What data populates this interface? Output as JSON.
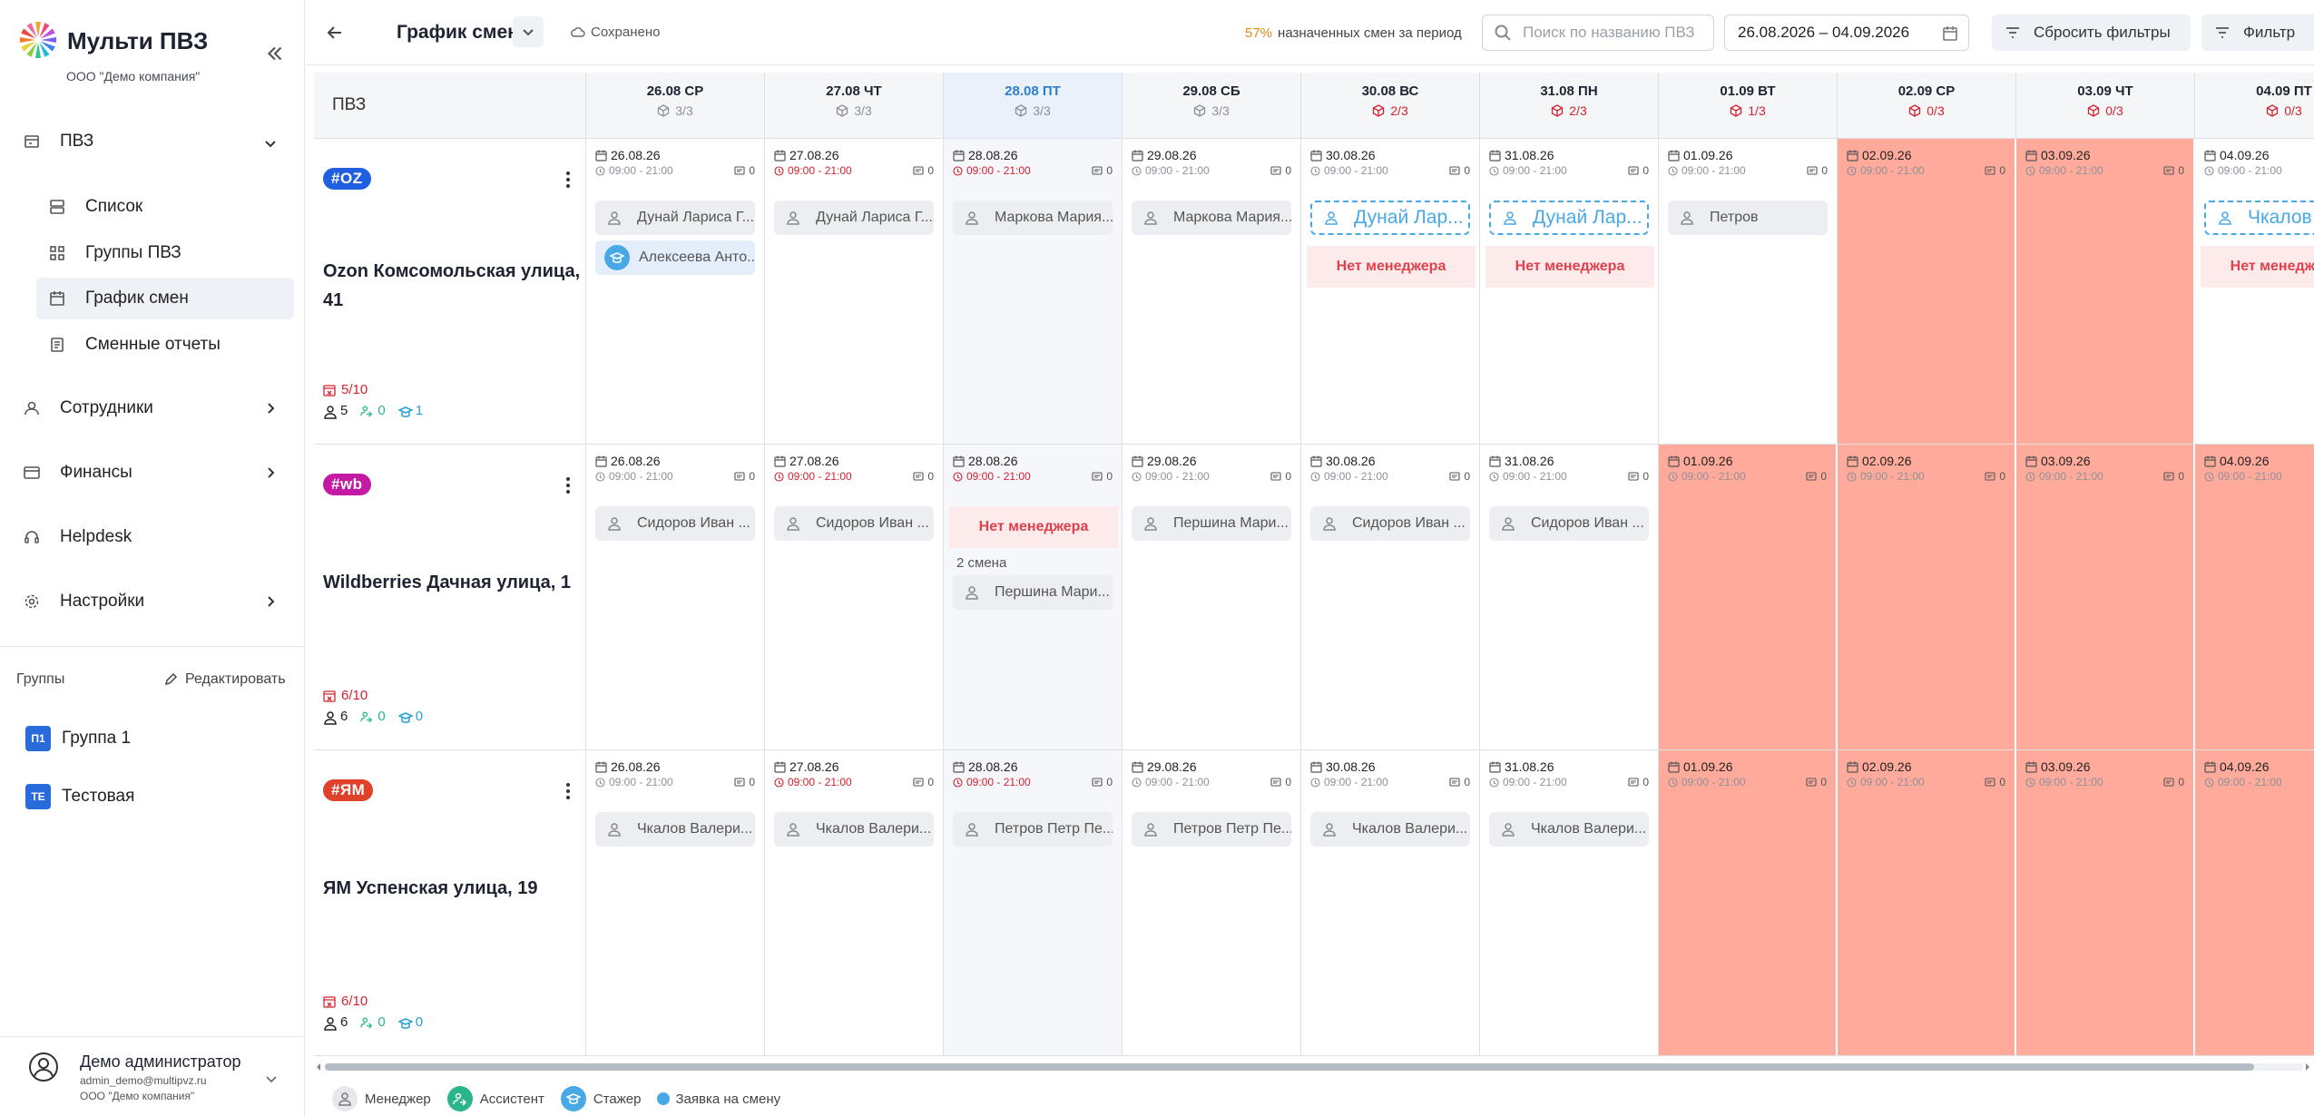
{
  "app": {
    "title": "Мульти ПВЗ",
    "org": "ООО \"Демо компания\""
  },
  "nav": {
    "pvz": "ПВЗ",
    "sub": [
      "Список",
      "Группы ПВЗ",
      "График смен",
      "Сменные отчеты"
    ],
    "employees": "Сотрудники",
    "finance": "Финансы",
    "helpdesk": "Helpdesk",
    "settings": "Настройки"
  },
  "groups": {
    "header": "Группы",
    "edit": "Редактировать",
    "items": [
      {
        "badge": "П1",
        "name": "Группа 1"
      },
      {
        "badge": "ТЕ",
        "name": "Тестовая"
      }
    ]
  },
  "user": {
    "name": "Демо администратор",
    "email": "admin_demo@multipvz.ru",
    "org": "ООО \"Демо компания\""
  },
  "header": {
    "title": "График смен",
    "saved": "Сохранено",
    "percent": "57%",
    "percent_label": "назначенных смен за период",
    "search_placeholder": "Поиск по названию ПВЗ",
    "date_range": "26.08.2026 – 04.09.2026",
    "reset": "Сбросить фильтры",
    "filter": "Фильтр"
  },
  "grid": {
    "pvz_header": "ПВЗ",
    "days": [
      {
        "label": "26.08 СР",
        "count": "3/3",
        "status": "ok"
      },
      {
        "label": "27.08 ЧТ",
        "count": "3/3",
        "status": "ok"
      },
      {
        "label": "28.08 ПТ",
        "count": "3/3",
        "status": "today"
      },
      {
        "label": "29.08 СБ",
        "count": "3/3",
        "status": "ok"
      },
      {
        "label": "30.08 ВС",
        "count": "2/3",
        "status": "bad"
      },
      {
        "label": "31.08 ПН",
        "count": "2/3",
        "status": "bad"
      },
      {
        "label": "01.09 ВТ",
        "count": "1/3",
        "status": "bad"
      },
      {
        "label": "02.09 СР",
        "count": "0/3",
        "status": "bad"
      },
      {
        "label": "03.09 ЧТ",
        "count": "0/3",
        "status": "bad"
      },
      {
        "label": "04.09 ПТ",
        "count": "0/3",
        "status": "bad"
      }
    ],
    "dates": [
      "26.08.26",
      "27.08.26",
      "28.08.26",
      "29.08.26",
      "30.08.26",
      "31.08.26",
      "01.09.26",
      "02.09.26",
      "03.09.26",
      "04.09.26"
    ],
    "time": "09:00 - 21:00",
    "cell_count": "0",
    "no_manager": "Нет менеджера",
    "shift2_label": "2 смена",
    "rows": [
      {
        "tag": "#OZ",
        "tag_color": "#1f5fe0",
        "name": "Ozon Комсомольская улица, 41",
        "shifts": "5/10",
        "managers": "5",
        "assistants": "0",
        "trainees": "1",
        "cells": [
          {
            "employees": [
              {
                "name": "Дунай Лариса Г...",
                "role": "m"
              },
              {
                "name": "Алексеева Анто...",
                "role": "s"
              }
            ]
          },
          {
            "employees": [
              {
                "name": "Дунай Лариса Г...",
                "role": "m"
              }
            ]
          },
          {
            "employees": [
              {
                "name": "Маркова Мария...",
                "role": "m"
              }
            ]
          },
          {
            "employees": [
              {
                "name": "Маркова Мария...",
                "role": "m"
              }
            ]
          },
          {
            "employees": [
              {
                "name": "Дунай Лар...",
                "role": "r"
              }
            ],
            "no_manager": true
          },
          {
            "employees": [
              {
                "name": "Дунай Лар...",
                "role": "r"
              }
            ],
            "no_manager": true
          },
          {
            "employees": [
              {
                "name": "Петров",
                "role": "m"
              }
            ]
          },
          {
            "off": true
          },
          {
            "off": true
          },
          {
            "employees": [
              {
                "name": "Чкалов",
                "role": "r"
              }
            ],
            "no_manager": true
          }
        ]
      },
      {
        "tag": "#wb",
        "tag_color": "#c41aa3",
        "name": "Wildberries Дачная улица, 1",
        "shifts": "6/10",
        "managers": "6",
        "assistants": "0",
        "trainees": "0",
        "cells": [
          {
            "employees": [
              {
                "name": "Сидоров Иван ...",
                "role": "m"
              }
            ]
          },
          {
            "employees": [
              {
                "name": "Сидоров Иван ...",
                "role": "m"
              }
            ]
          },
          {
            "no_manager_top": true,
            "shift2": [
              {
                "name": "Першина Мари...",
                "role": "m"
              }
            ]
          },
          {
            "employees": [
              {
                "name": "Першина Мари...",
                "role": "m"
              }
            ]
          },
          {
            "employees": [
              {
                "name": "Сидоров Иван ...",
                "role": "m"
              }
            ]
          },
          {
            "employees": [
              {
                "name": "Сидоров Иван ...",
                "role": "m"
              }
            ]
          },
          {
            "off": true
          },
          {
            "off": true
          },
          {
            "off": true
          },
          {
            "off": true
          }
        ]
      },
      {
        "tag": "#ЯМ",
        "tag_color": "#e0412a",
        "name": "ЯМ Успенская улица, 19",
        "shifts": "6/10",
        "managers": "6",
        "assistants": "0",
        "trainees": "0",
        "cells": [
          {
            "employees": [
              {
                "name": "Чкалов Валери...",
                "role": "m"
              }
            ]
          },
          {
            "employees": [
              {
                "name": "Чкалов Валери...",
                "role": "m"
              }
            ]
          },
          {
            "employees": [
              {
                "name": "Петров Петр Пе...",
                "role": "m"
              }
            ]
          },
          {
            "employees": [
              {
                "name": "Петров Петр Пе...",
                "role": "m"
              }
            ]
          },
          {
            "employees": [
              {
                "name": "Чкалов Валери...",
                "role": "m"
              }
            ]
          },
          {
            "employees": [
              {
                "name": "Чкалов Валери...",
                "role": "m"
              }
            ]
          },
          {
            "off": true
          },
          {
            "off": true
          },
          {
            "off": true
          },
          {
            "off": true
          }
        ]
      }
    ]
  },
  "legend": {
    "manager": "Менеджер",
    "assistant": "Ассистент",
    "trainee": "Стажер",
    "request": "Заявка на смену"
  },
  "colors": {
    "accent": "#2a7fd0",
    "danger": "#d2222f",
    "off_day": "#ffaa9a",
    "warning": "#e0891b",
    "trainee": "#48a9e6",
    "assistant": "#2bb58a"
  }
}
